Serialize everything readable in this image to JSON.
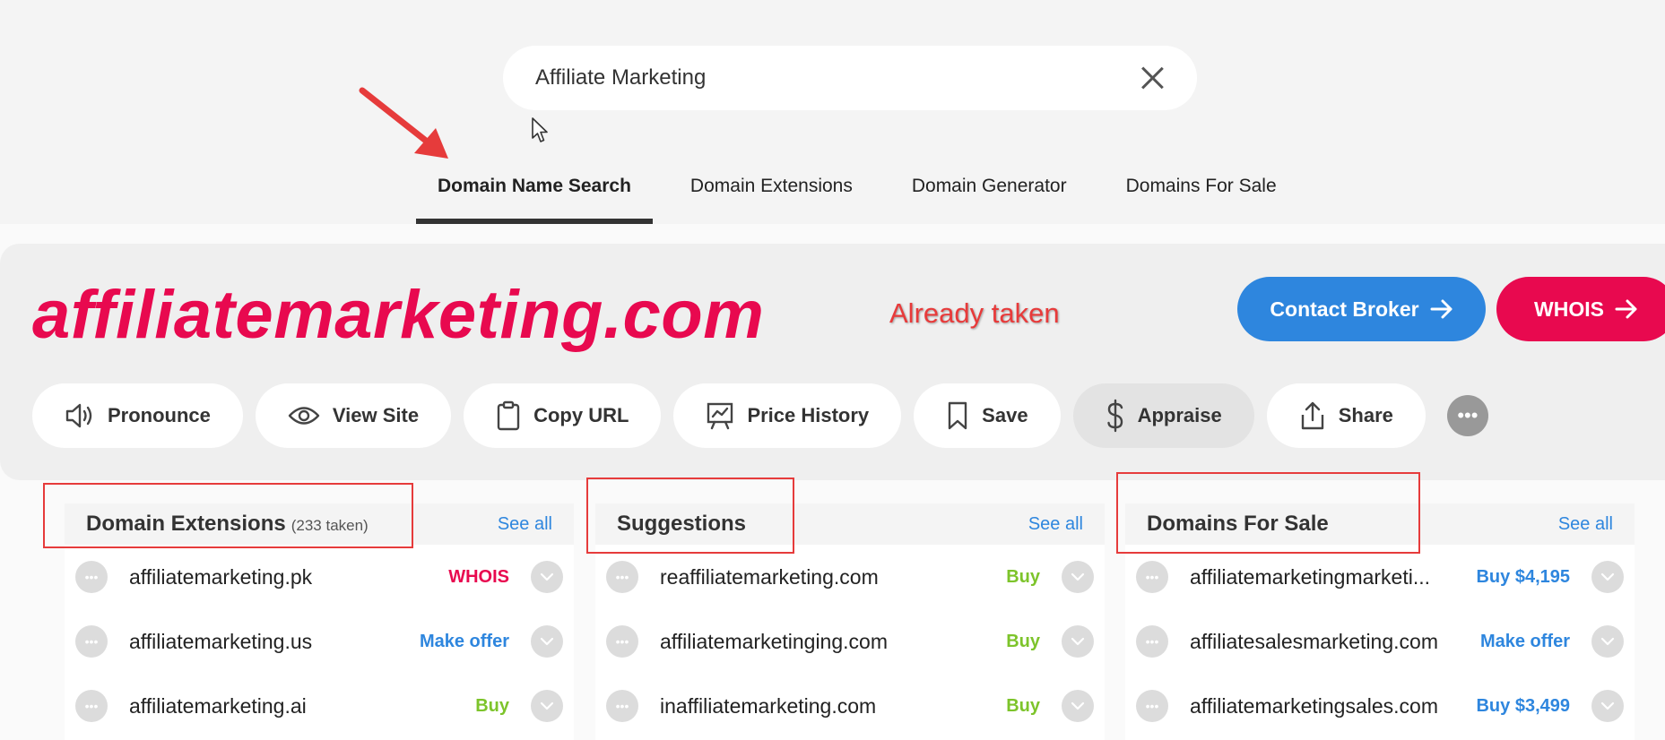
{
  "search": {
    "value": "Affiliate Marketing"
  },
  "tabs": [
    {
      "label": "Domain Name Search",
      "active": true
    },
    {
      "label": "Domain Extensions",
      "active": false
    },
    {
      "label": "Domain Generator",
      "active": false
    },
    {
      "label": "Domains For Sale",
      "active": false
    }
  ],
  "result": {
    "domain": "affiliatemarketing.com",
    "note": "Already taken",
    "contact_label": "Contact Broker",
    "whois_label": "WHOIS"
  },
  "actions": [
    {
      "label": "Pronounce",
      "icon": "speaker-icon"
    },
    {
      "label": "View Site",
      "icon": "eye-icon"
    },
    {
      "label": "Copy URL",
      "icon": "clipboard-icon"
    },
    {
      "label": "Price History",
      "icon": "chart-icon"
    },
    {
      "label": "Save",
      "icon": "bookmark-icon"
    },
    {
      "label": "Appraise",
      "icon": "dollar-icon"
    },
    {
      "label": "Share",
      "icon": "share-icon"
    }
  ],
  "panels": {
    "extensions": {
      "title": "Domain Extensions",
      "count": "(233 taken)",
      "see_all": "See all",
      "rows": [
        {
          "name": "affiliatemarketing.pk",
          "action": "WHOIS"
        },
        {
          "name": "affiliatemarketing.us",
          "action": "Make offer"
        },
        {
          "name": "affiliatemarketing.ai",
          "action": "Buy"
        }
      ]
    },
    "suggestions": {
      "title": "Suggestions",
      "see_all": "See all",
      "rows": [
        {
          "name": "reaffiliatemarketing.com",
          "action": "Buy"
        },
        {
          "name": "affiliatemarketinging.com",
          "action": "Buy"
        },
        {
          "name": "inaffiliatemarketing.com",
          "action": "Buy"
        }
      ]
    },
    "for_sale": {
      "title": "Domains For Sale",
      "see_all": "See all",
      "rows": [
        {
          "name": "affiliatemarketingmarketi...",
          "action": "Buy $4,195"
        },
        {
          "name": "affiliatesalesmarketing.com",
          "action": "Make offer"
        },
        {
          "name": "affiliatemarketingsales.com",
          "action": "Buy $3,499"
        }
      ]
    }
  },
  "colors": {
    "brand_pink": "#e8094f",
    "link_blue": "#2e86de",
    "buy_green": "#7dc42b",
    "annotation_red": "#e63b3b"
  }
}
